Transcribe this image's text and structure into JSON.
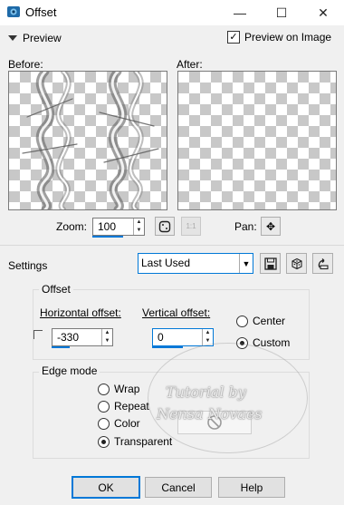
{
  "window": {
    "title": "Offset",
    "minimize": "—",
    "maximize": "☐",
    "close": "✕"
  },
  "preview": {
    "toggle_label": "Preview",
    "preview_on_image_label": "Preview on Image",
    "preview_on_image_checked": true,
    "before_label": "Before:",
    "after_label": "After:",
    "zoom_label": "Zoom:",
    "zoom_value": "100",
    "pan_label": "Pan:"
  },
  "settings": {
    "label": "Settings",
    "preset_value": "Last Used"
  },
  "offset_group": {
    "title": "Offset",
    "horizontal_label": "Horizontal offset:",
    "horizontal_value": "-330",
    "vertical_label": "Vertical offset:",
    "vertical_value": "0",
    "center_label": "Center",
    "custom_label": "Custom",
    "selected": "Custom"
  },
  "edge_mode": {
    "title": "Edge mode",
    "options": [
      "Wrap",
      "Repeat",
      "Color",
      "Transparent"
    ],
    "selected": "Transparent"
  },
  "watermark": {
    "line1": "Tutorial by",
    "line2": "Nensa Novaes"
  },
  "buttons": {
    "ok": "OK",
    "cancel": "Cancel",
    "help": "Help"
  },
  "colors": {
    "accent": "#0078d7",
    "checker": "#c8c8c8"
  }
}
